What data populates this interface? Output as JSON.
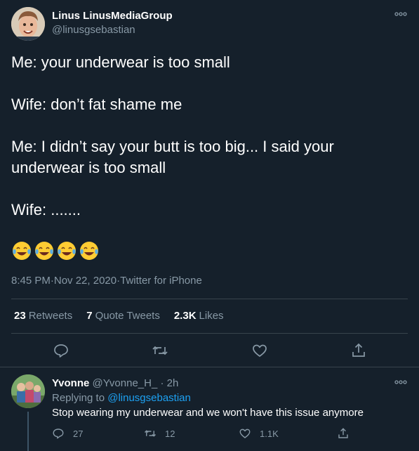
{
  "author": {
    "name": "Linus LinusMediaGroup",
    "handle": "@linusgsebastian"
  },
  "tweet": {
    "paragraphs": [
      "Me: your underwear is too small",
      "Wife: don’t fat shame me",
      "Me: I didn’t say your butt is too big... I said your underwear is too small",
      "Wife: ......."
    ],
    "emoji": [
      "😂",
      "😂",
      "😂",
      "😂"
    ],
    "time": "8:45 PM",
    "date": "Nov 22, 2020",
    "source": "Twitter for iPhone",
    "sep": " · "
  },
  "stats": {
    "retweets_count": "23",
    "retweets_label": "Retweets",
    "quotes_count": "7",
    "quotes_label": "Quote Tweets",
    "likes_count": "2.3K",
    "likes_label": "Likes"
  },
  "actions": [
    "reply-icon",
    "retweet-icon",
    "like-icon",
    "share-icon"
  ],
  "reply": {
    "name": "Yvonne",
    "handle": "@Yvonne_H_",
    "dot": " · ",
    "time": "2h",
    "replying_prefix": "Replying to ",
    "replying_mention": "@linusgsebastian",
    "text": "Stop wearing my underwear and we won't have this issue anymore",
    "reply_count": "27",
    "retweet_count": "12",
    "like_count": "1.1K"
  },
  "colors": {
    "background": "#15202b",
    "secondary_text": "#8899a6",
    "link": "#1da1f2",
    "divider": "#38444d"
  }
}
